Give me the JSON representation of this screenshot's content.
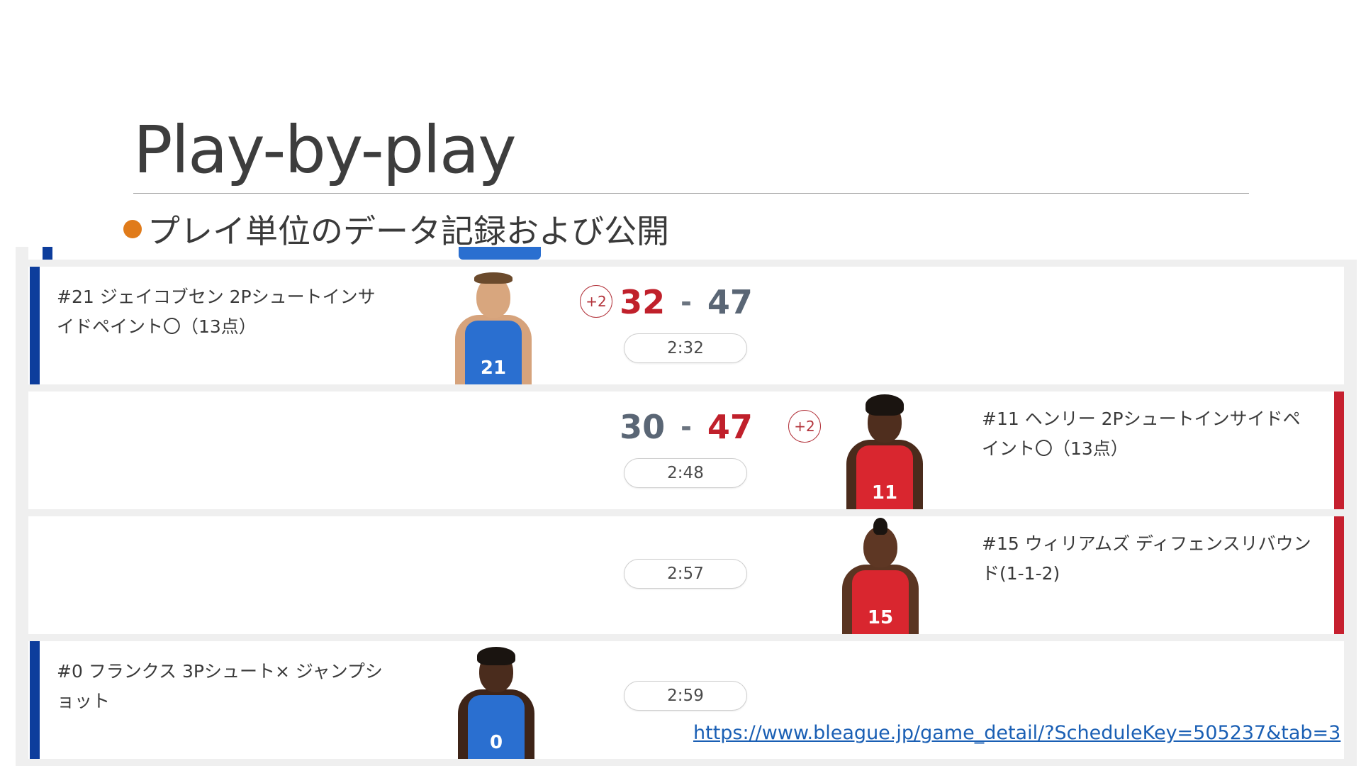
{
  "slide": {
    "title": "Play-by-play",
    "bullet": "プレイ単位のデータ記録および公開",
    "source_url": "https://www.bleague.jp/game_detail/?ScheduleKey=505237&tab=3"
  },
  "colors": {
    "home_team": "#0d3d9c",
    "away_team": "#c6202f",
    "score_red": "#c0202b",
    "score_grey": "#5a6675",
    "bullet": "#e07b1a",
    "link": "#1a5fb4"
  },
  "plays": [
    {
      "side": "home",
      "text": "#21 ジェイコブセン 2Pシュートインサイドペイント〇（13点）",
      "points_badge": "+2",
      "score_home": "32",
      "score_sep": "-",
      "score_away": "47",
      "time": "2:32",
      "player_number": "21"
    },
    {
      "side": "away",
      "text": "#11 ヘンリー 2Pシュートインサイドペイント〇（13点）",
      "points_badge": "+2",
      "score_home": "30",
      "score_sep": "-",
      "score_away": "47",
      "time": "2:48",
      "player_number": "11"
    },
    {
      "side": "away",
      "text": "#15 ウィリアムズ ディフェンスリバウンド(1-1-2)",
      "time": "2:57",
      "player_number": "15"
    },
    {
      "side": "home",
      "text": "#0 フランクス 3Pシュート× ジャンプショット",
      "time": "2:59",
      "player_number": "0"
    }
  ]
}
